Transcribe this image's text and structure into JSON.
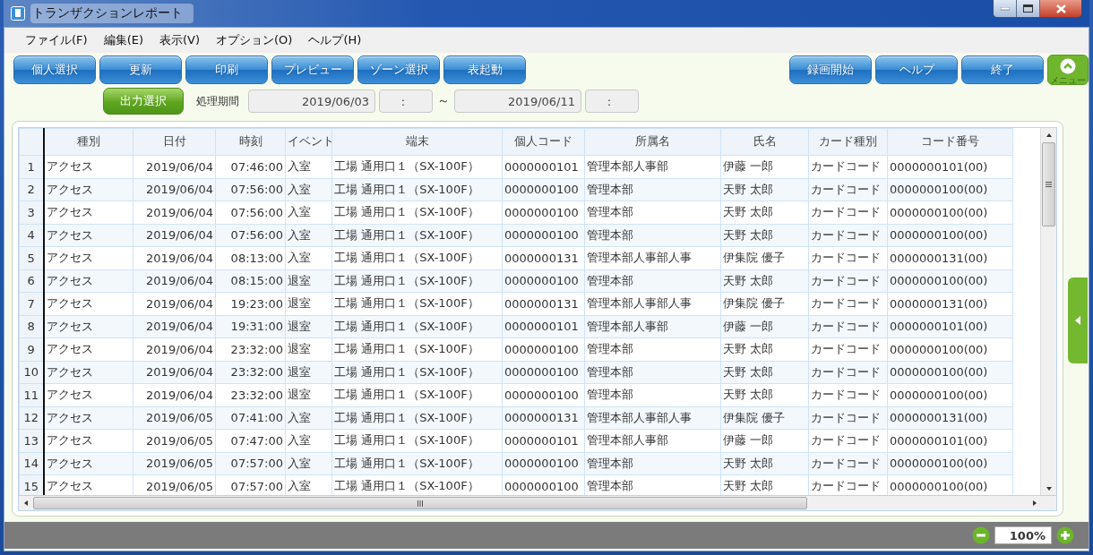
{
  "window": {
    "title": "トランザクションレポート"
  },
  "menu": [
    "ファイル(F)",
    "編集(E)",
    "表示(V)",
    "オプション(O)",
    "ヘルプ(H)"
  ],
  "toolbar": {
    "left": [
      "個人選択",
      "更新",
      "印刷",
      "プレビュー",
      "ゾーン選択",
      "表起動"
    ],
    "right": [
      "録画開始",
      "ヘルプ",
      "終了"
    ],
    "menu_toggle": "メニュー"
  },
  "filter": {
    "output_button": "出力選択",
    "period_label": "処理期間",
    "from_date": "2019/06/03",
    "from_time": ":",
    "separator": "～",
    "to_date": "2019/06/11",
    "to_time": ":"
  },
  "table": {
    "columns": [
      "種別",
      "日付",
      "時刻",
      "イベント",
      "端末",
      "個人コード",
      "所属名",
      "氏名",
      "カード種別",
      "コード番号"
    ],
    "rows": [
      {
        "number": "1",
        "cells": [
          "アクセス",
          "2019/06/04",
          "07:46:00",
          "入室",
          "工場 通用口１（SX-100F）",
          "0000000101",
          "管理本部人事部",
          "伊藤 一郎",
          "カードコード",
          "0000000101(00)"
        ]
      },
      {
        "number": "2",
        "cells": [
          "アクセス",
          "2019/06/04",
          "07:56:00",
          "入室",
          "工場 通用口１（SX-100F）",
          "0000000100",
          "管理本部",
          "天野 太郎",
          "カードコード",
          "0000000100(00)"
        ]
      },
      {
        "number": "3",
        "cells": [
          "アクセス",
          "2019/06/04",
          "07:56:00",
          "入室",
          "工場 通用口１（SX-100F）",
          "0000000100",
          "管理本部",
          "天野 太郎",
          "カードコード",
          "0000000100(00)"
        ]
      },
      {
        "number": "4",
        "cells": [
          "アクセス",
          "2019/06/04",
          "07:56:00",
          "入室",
          "工場 通用口１（SX-100F）",
          "0000000100",
          "管理本部",
          "天野 太郎",
          "カードコード",
          "0000000100(00)"
        ]
      },
      {
        "number": "5",
        "cells": [
          "アクセス",
          "2019/06/04",
          "08:13:00",
          "入室",
          "工場 通用口１（SX-100F）",
          "0000000131",
          "管理本部人事部人事",
          "伊集院 優子",
          "カードコード",
          "0000000131(00)"
        ]
      },
      {
        "number": "6",
        "cells": [
          "アクセス",
          "2019/06/04",
          "08:15:00",
          "退室",
          "工場 通用口１（SX-100F）",
          "0000000100",
          "管理本部",
          "天野 太郎",
          "カードコード",
          "0000000100(00)"
        ]
      },
      {
        "number": "7",
        "cells": [
          "アクセス",
          "2019/06/04",
          "19:23:00",
          "退室",
          "工場 通用口１（SX-100F）",
          "0000000131",
          "管理本部人事部人事",
          "伊集院 優子",
          "カードコード",
          "0000000131(00)"
        ]
      },
      {
        "number": "8",
        "cells": [
          "アクセス",
          "2019/06/04",
          "19:31:00",
          "退室",
          "工場 通用口１（SX-100F）",
          "0000000101",
          "管理本部人事部",
          "伊藤 一郎",
          "カードコード",
          "0000000101(00)"
        ]
      },
      {
        "number": "9",
        "cells": [
          "アクセス",
          "2019/06/04",
          "23:32:00",
          "退室",
          "工場 通用口１（SX-100F）",
          "0000000100",
          "管理本部",
          "天野 太郎",
          "カードコード",
          "0000000100(00)"
        ]
      },
      {
        "number": "10",
        "cells": [
          "アクセス",
          "2019/06/04",
          "23:32:00",
          "退室",
          "工場 通用口１（SX-100F）",
          "0000000100",
          "管理本部",
          "天野 太郎",
          "カードコード",
          "0000000100(00)"
        ]
      },
      {
        "number": "11",
        "cells": [
          "アクセス",
          "2019/06/04",
          "23:32:00",
          "退室",
          "工場 通用口１（SX-100F）",
          "0000000100",
          "管理本部",
          "天野 太郎",
          "カードコード",
          "0000000100(00)"
        ]
      },
      {
        "number": "12",
        "cells": [
          "アクセス",
          "2019/06/05",
          "07:41:00",
          "入室",
          "工場 通用口１（SX-100F）",
          "0000000131",
          "管理本部人事部人事",
          "伊集院 優子",
          "カードコード",
          "0000000131(00)"
        ]
      },
      {
        "number": "13",
        "cells": [
          "アクセス",
          "2019/06/05",
          "07:47:00",
          "入室",
          "工場 通用口１（SX-100F）",
          "0000000101",
          "管理本部人事部",
          "伊藤 一郎",
          "カードコード",
          "0000000101(00)"
        ]
      },
      {
        "number": "14",
        "cells": [
          "アクセス",
          "2019/06/05",
          "07:57:00",
          "入室",
          "工場 通用口１（SX-100F）",
          "0000000100",
          "管理本部",
          "天野 太郎",
          "カードコード",
          "0000000100(00)"
        ]
      },
      {
        "number": "15",
        "cells": [
          "アクセス",
          "2019/06/05",
          "07:57:00",
          "入室",
          "工場 通用口１（SX-100F）",
          "0000000100",
          "管理本部",
          "天野 太郎",
          "カードコード",
          "0000000100(00)"
        ]
      }
    ]
  },
  "status_bar": {
    "zoom": "100%"
  }
}
